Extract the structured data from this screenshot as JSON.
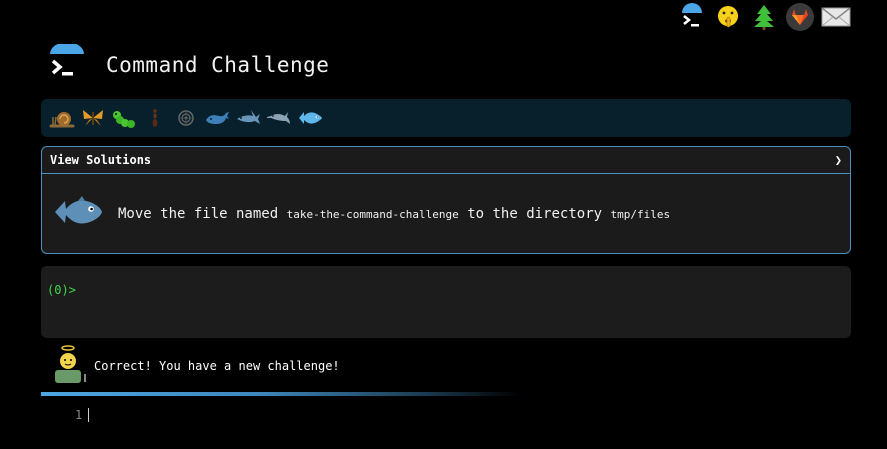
{
  "app": {
    "title": "Command Challenge"
  },
  "top_nav": [
    {
      "name": "command-challenge-logo-icon"
    },
    {
      "name": "shushing-face-icon"
    },
    {
      "name": "tree-icon"
    },
    {
      "name": "gitlab-icon"
    },
    {
      "name": "envelope-icon"
    }
  ],
  "levels": [
    {
      "name": "snail-icon",
      "active": false
    },
    {
      "name": "butterfly-icon",
      "active": false
    },
    {
      "name": "caterpillar-icon",
      "active": false
    },
    {
      "name": "ant-icon",
      "active": false
    },
    {
      "name": "shell-icon",
      "active": false
    },
    {
      "name": "whale-icon",
      "active": false
    },
    {
      "name": "shark-icon",
      "active": false
    },
    {
      "name": "dolphin-icon",
      "active": false
    },
    {
      "name": "fish-icon",
      "active": true
    }
  ],
  "challenge": {
    "header_label": "View Solutions",
    "header_chevron": "❯",
    "task_prefix": "Move the file named ",
    "task_file": "take-the-command-challenge",
    "task_middle": " to the directory ",
    "task_dir": "tmp/files"
  },
  "terminal": {
    "prompt": "(0)>",
    "input_value": ""
  },
  "feedback": {
    "message": "Correct! You have a new challenge!"
  },
  "editor": {
    "line_number": "1"
  },
  "colors": {
    "accent": "#4a90b8",
    "prompt": "#3fd84a",
    "background": "#000000"
  }
}
